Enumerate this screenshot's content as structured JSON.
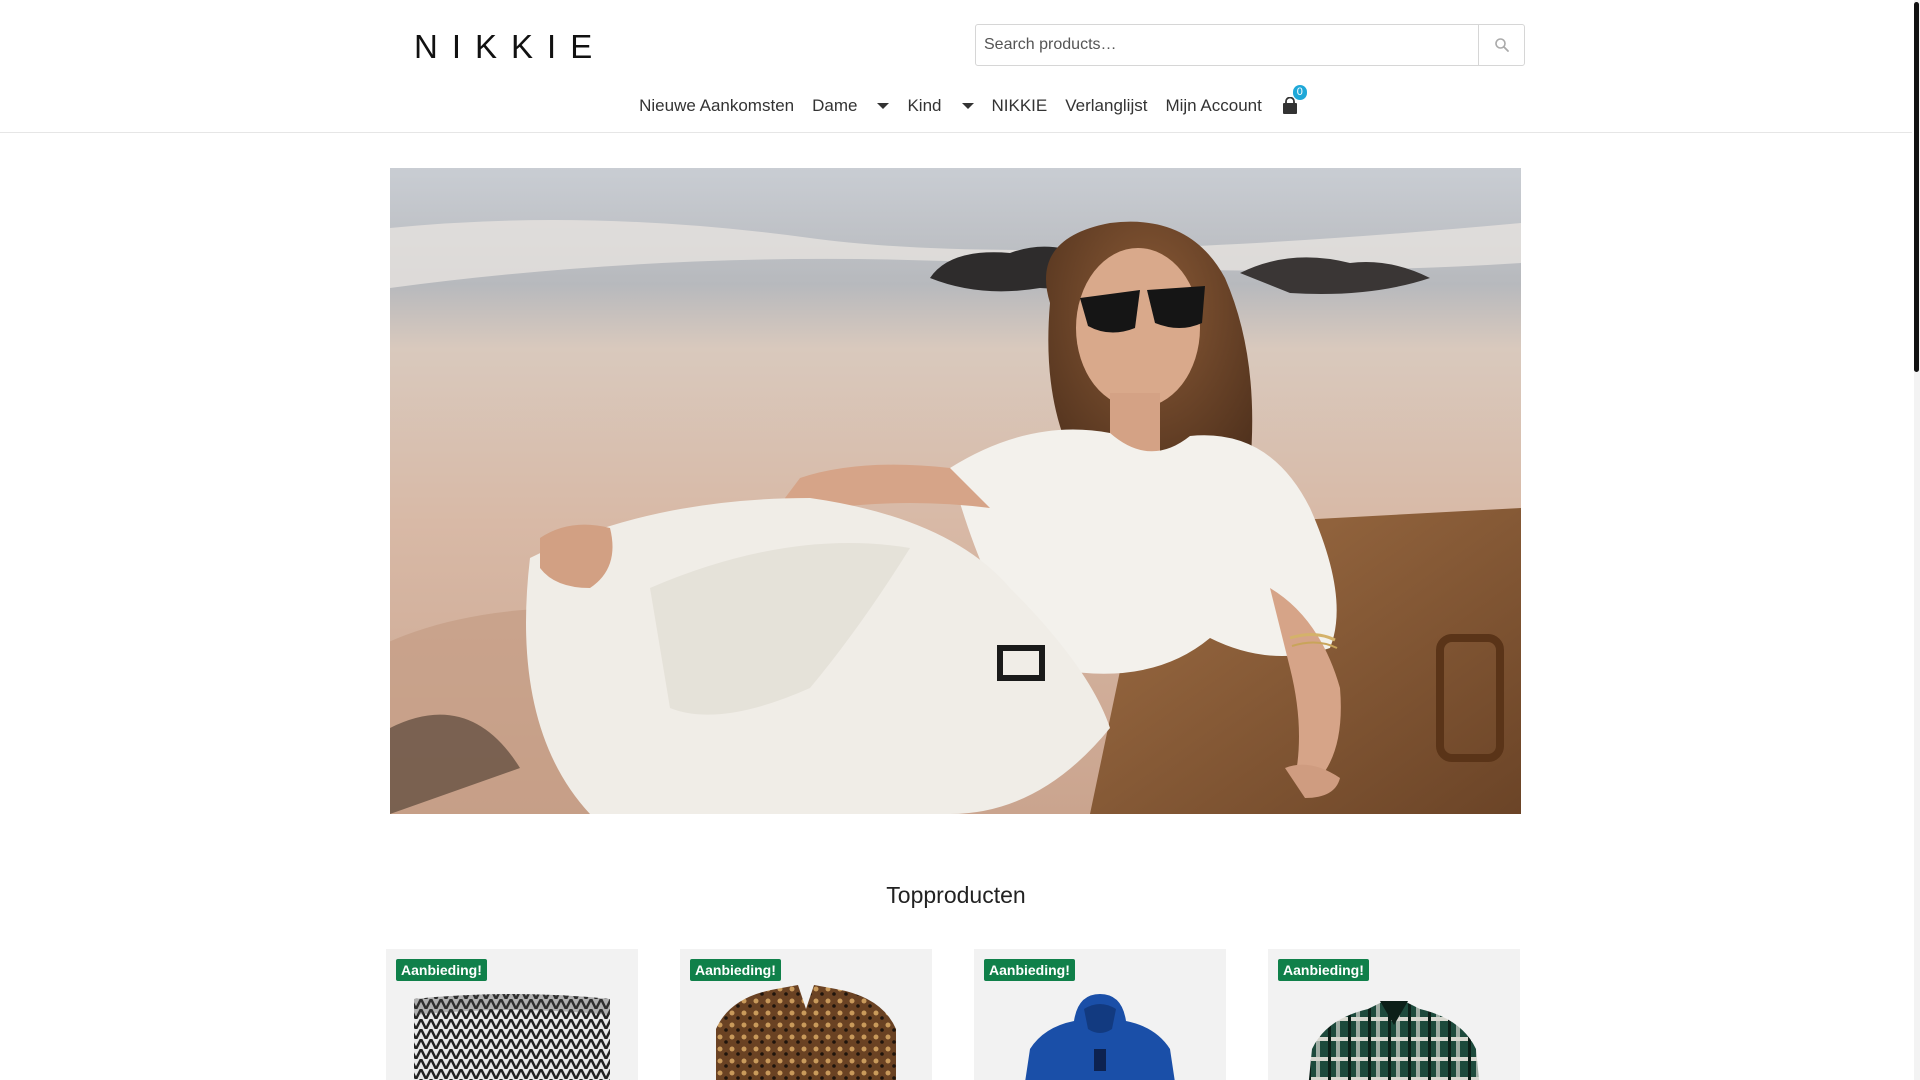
{
  "brand": {
    "logo_text": "NIKKIE"
  },
  "search": {
    "placeholder": "Search products…",
    "icon": "search-icon"
  },
  "nav": {
    "items": [
      {
        "label": "Nieuwe Aankomsten",
        "has_dropdown": false
      },
      {
        "label": "Dame",
        "has_dropdown": true
      },
      {
        "label": "Kind",
        "has_dropdown": true
      },
      {
        "label": "NIKKIE",
        "has_dropdown": false
      },
      {
        "label": "Verlanglijst",
        "has_dropdown": false
      },
      {
        "label": "Mijn Account",
        "has_dropdown": false
      }
    ],
    "cart": {
      "icon": "shopping-bag-icon",
      "count": "0"
    }
  },
  "hero": {
    "image": "woman-in-white-linen-on-beach"
  },
  "sections": {
    "top_products_title": "Topproducten"
  },
  "products": [
    {
      "badge": "Aanbieding!",
      "image": "black-white-print-off-shoulder-top"
    },
    {
      "badge": "Aanbieding!",
      "image": "brown-paisley-blouse"
    },
    {
      "badge": "Aanbieding!",
      "image": "blue-hoodie"
    },
    {
      "badge": "Aanbieding!",
      "image": "green-check-shirt"
    }
  ],
  "colors": {
    "sale_badge": "#10804a",
    "cart_badge": "#1fa8d8",
    "text": "#333333"
  }
}
